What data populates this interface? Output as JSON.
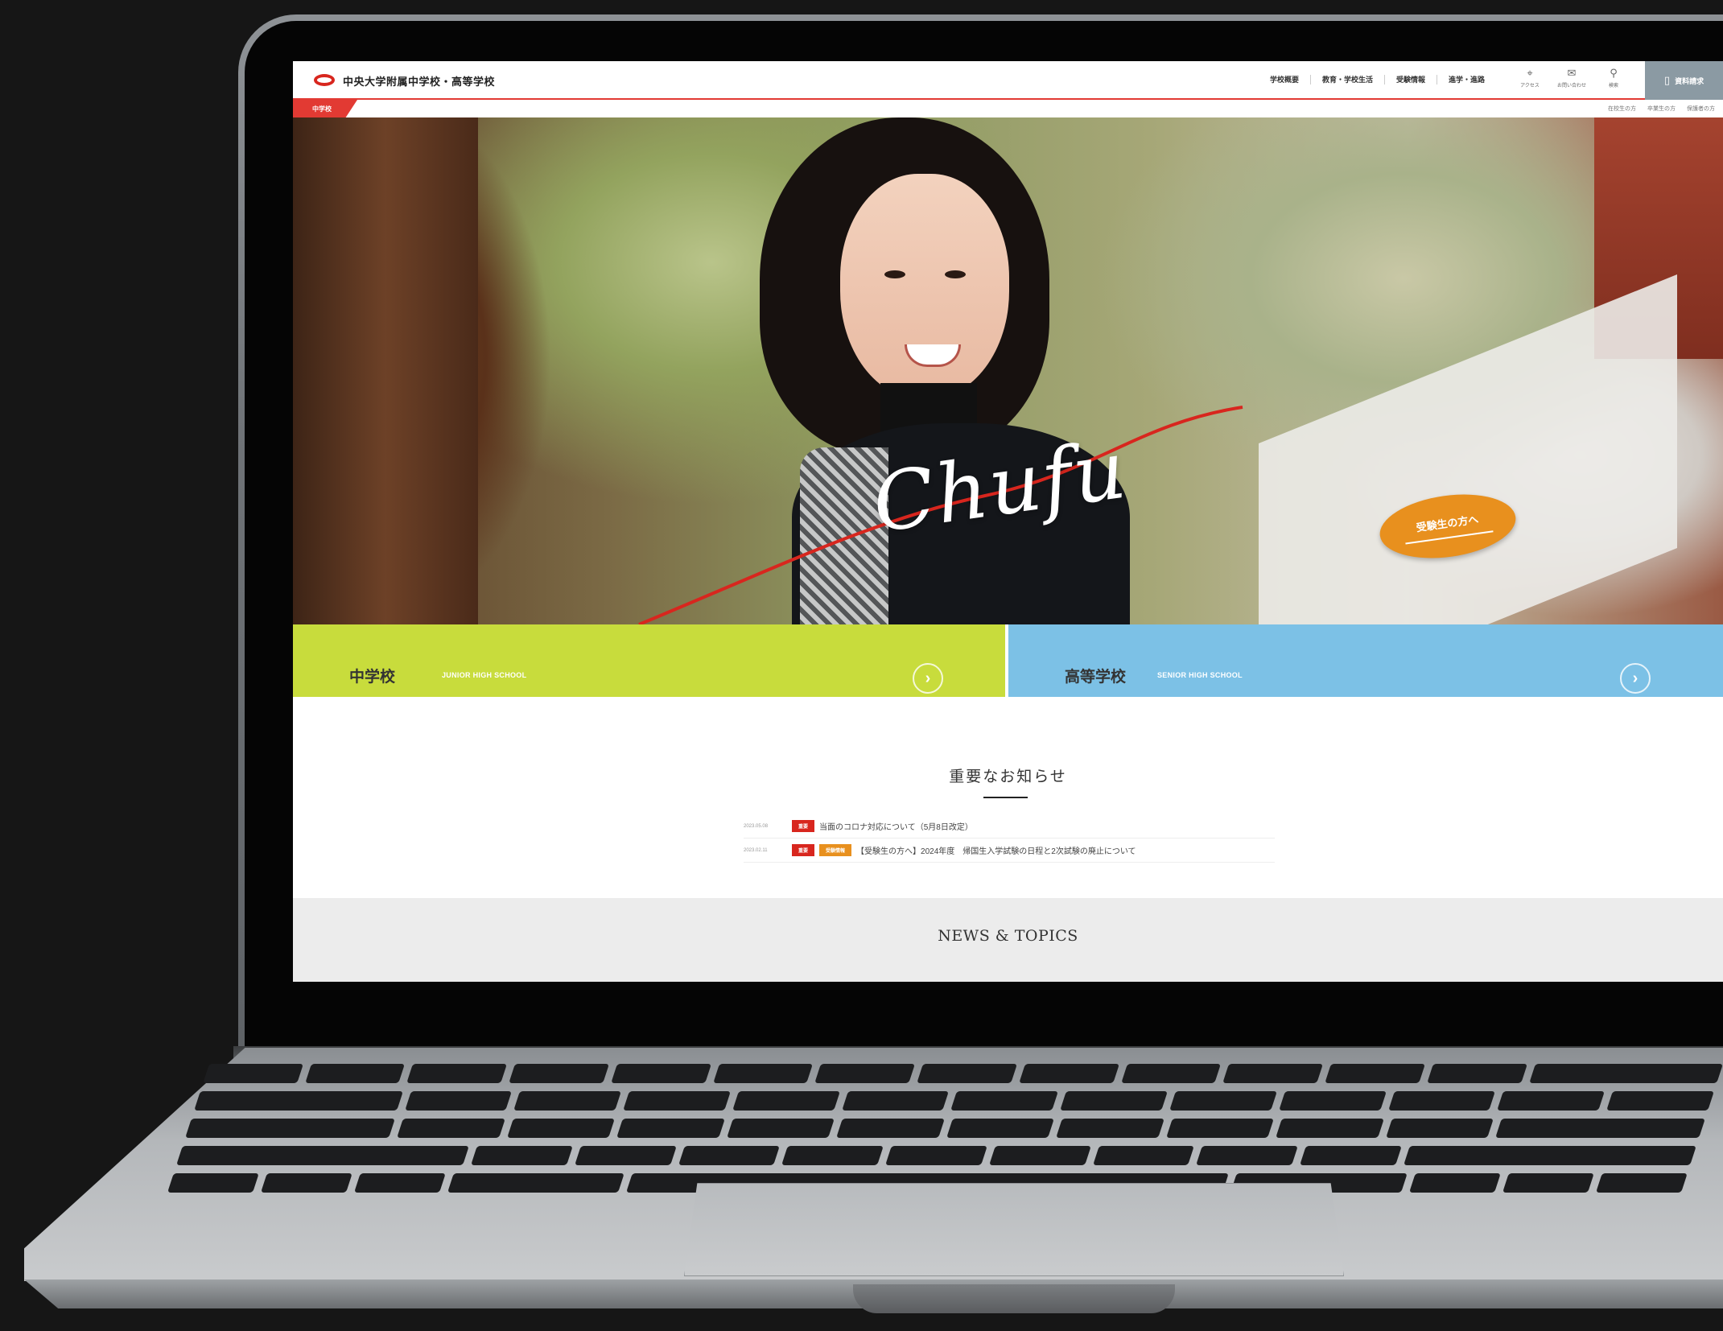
{
  "site": {
    "title": "中央大学附属中学校・高等学校"
  },
  "header": {
    "nav": [
      "学校概要",
      "教育・学校生活",
      "受験情報",
      "進学・進路"
    ],
    "utility": [
      {
        "icon": "map-pin-icon",
        "label": "アクセス"
      },
      {
        "icon": "mail-icon",
        "label": "お問い合わせ"
      },
      {
        "icon": "search-icon",
        "label": "検索"
      }
    ],
    "request_button": "資料請求"
  },
  "subbar": {
    "home_label": "中学校",
    "links": [
      "在校生の方",
      "卒業生の方",
      "保護者の方"
    ]
  },
  "hero": {
    "script_text": "Chufu",
    "cta_label": "受験生の方へ"
  },
  "banners": [
    {
      "jp": "中学校",
      "en": "JUNIOR HIGH SCHOOL",
      "arrow": "›",
      "color": "#c8dc3c"
    },
    {
      "jp": "高等学校",
      "en": "SENIOR HIGH SCHOOL",
      "arrow": "›",
      "color": "#7cc1e6"
    }
  ],
  "notices": {
    "title": "重要なお知らせ",
    "items": [
      {
        "date": "2023.05.08",
        "tags": [
          "重要"
        ],
        "text": "当面のコロナ対応について（5月8日改定）"
      },
      {
        "date": "2023.02.11",
        "tags": [
          "重要",
          "受験情報"
        ],
        "text": "【受験生の方へ】2024年度　帰国生入学試験の日程と2次試験の廃止について"
      }
    ]
  },
  "news": {
    "title": "NEWS & TOPICS"
  },
  "colors": {
    "accent_red": "#e23a33",
    "junior_green": "#c8dc3c",
    "senior_blue": "#7cc1e6",
    "cta_orange": "#e8901e"
  }
}
